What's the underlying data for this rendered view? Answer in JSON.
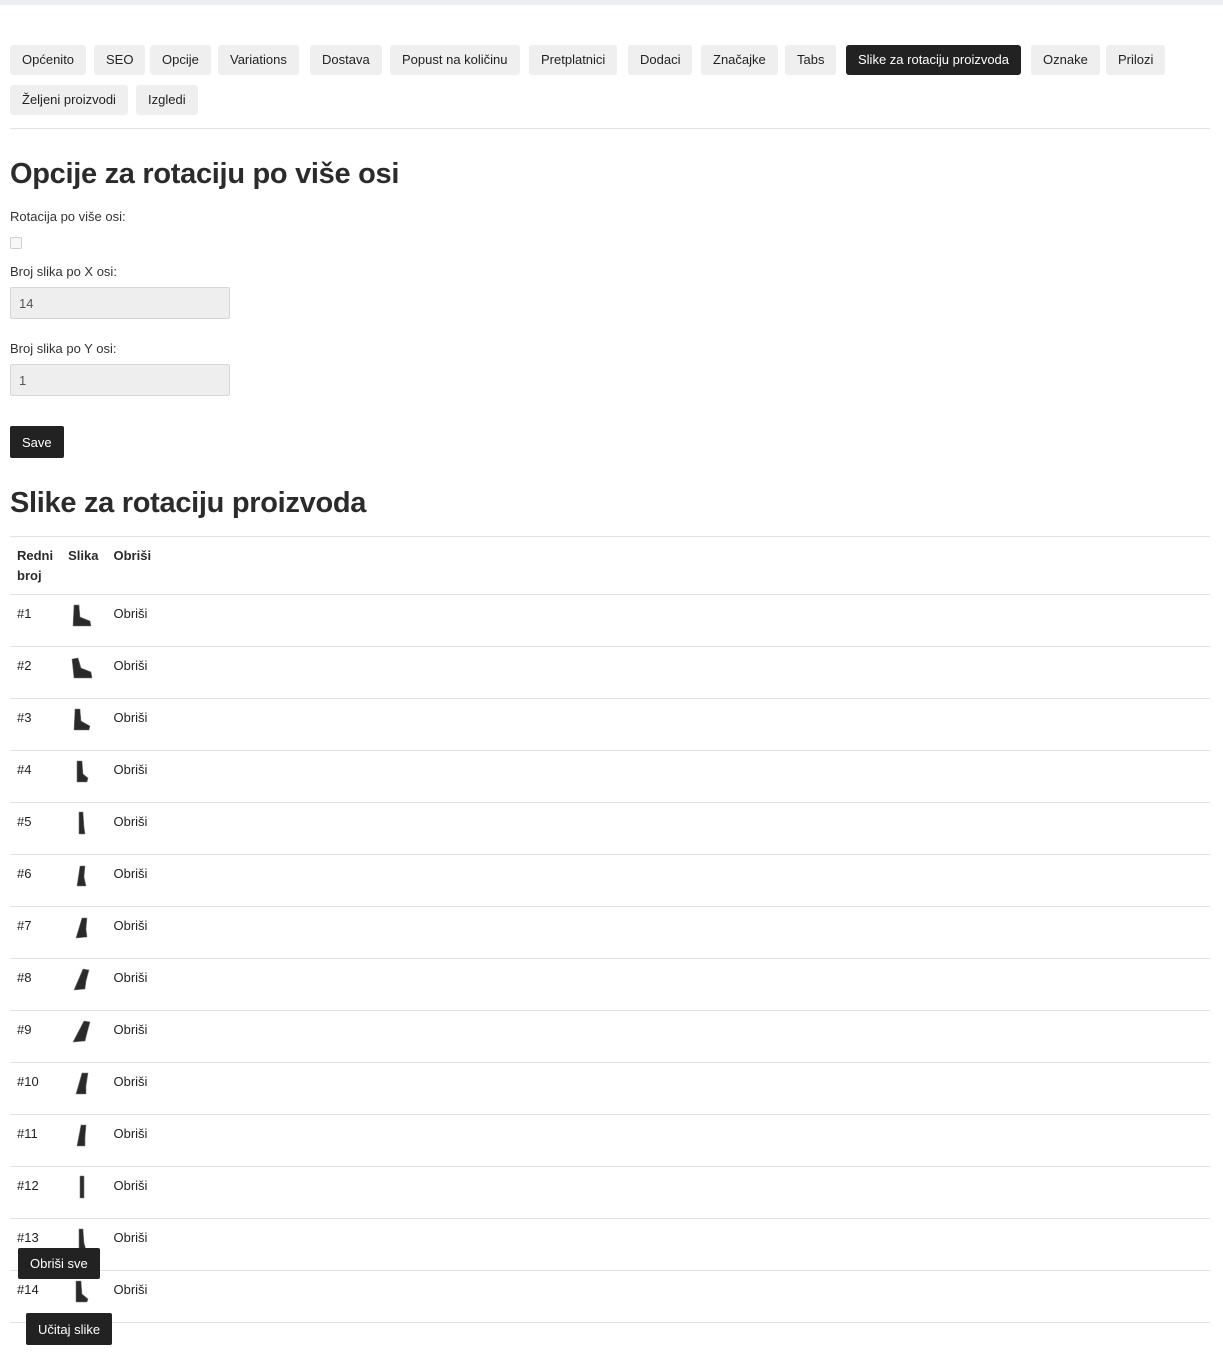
{
  "tabs": [
    {
      "label": "Općenito",
      "active": false
    },
    {
      "label": "SEO",
      "active": false
    },
    {
      "label": "Opcije",
      "active": false
    },
    {
      "label": "Variations",
      "active": false
    },
    {
      "label": "Dostava",
      "active": false
    },
    {
      "label": "Popust na količinu",
      "active": false
    },
    {
      "label": "Pretplatnici",
      "active": false
    },
    {
      "label": "Dodaci",
      "active": false
    },
    {
      "label": "Značajke",
      "active": false
    },
    {
      "label": "Tabs",
      "active": false
    },
    {
      "label": "Slike za rotaciju proizvoda",
      "active": true
    },
    {
      "label": "Oznake",
      "active": false
    },
    {
      "label": "Prilozi",
      "active": false
    },
    {
      "label": "Željeni proizvodi",
      "active": false
    },
    {
      "label": "Izgledi",
      "active": false
    }
  ],
  "options": {
    "title": "Opcije za rotaciju po više osi",
    "multi_axis_label": "Rotacija po više osi:",
    "multi_axis_checked": false,
    "x_label": "Broj slika po X osi:",
    "x_value": "14",
    "y_label": "Broj slika po Y osi:",
    "y_value": "1",
    "save_label": "Save"
  },
  "images": {
    "title": "Slike za rotaciju proizvoda",
    "headers": {
      "num": "Redni broj",
      "image": "Slika",
      "delete": "Obriši"
    },
    "rows": [
      {
        "num": "#1",
        "delete": "Obriši",
        "icon": "boot-thumbnail-icon"
      },
      {
        "num": "#2",
        "delete": "Obriši",
        "icon": "boot-thumbnail-icon"
      },
      {
        "num": "#3",
        "delete": "Obriši",
        "icon": "boot-thumbnail-icon"
      },
      {
        "num": "#4",
        "delete": "Obriši",
        "icon": "boot-thumbnail-icon"
      },
      {
        "num": "#5",
        "delete": "Obriši",
        "icon": "boot-thumbnail-icon"
      },
      {
        "num": "#6",
        "delete": "Obriši",
        "icon": "boot-thumbnail-icon"
      },
      {
        "num": "#7",
        "delete": "Obriši",
        "icon": "boot-thumbnail-icon"
      },
      {
        "num": "#8",
        "delete": "Obriši",
        "icon": "boot-thumbnail-icon"
      },
      {
        "num": "#9",
        "delete": "Obriši",
        "icon": "boot-thumbnail-icon"
      },
      {
        "num": "#10",
        "delete": "Obriši",
        "icon": "boot-thumbnail-icon"
      },
      {
        "num": "#11",
        "delete": "Obriši",
        "icon": "boot-thumbnail-icon"
      },
      {
        "num": "#12",
        "delete": "Obriši",
        "icon": "boot-thumbnail-icon"
      },
      {
        "num": "#13",
        "delete": "Obriši",
        "icon": "boot-thumbnail-icon"
      },
      {
        "num": "#14",
        "delete": "Obriši",
        "icon": "boot-thumbnail-icon"
      }
    ],
    "delete_all_label": "Obriši sve",
    "upload_label": "Učitaj slike"
  },
  "colors": {
    "active_tab_bg": "#222222",
    "tab_bg": "#efefef",
    "button_bg": "#222222",
    "input_bg": "#eeeeee"
  }
}
